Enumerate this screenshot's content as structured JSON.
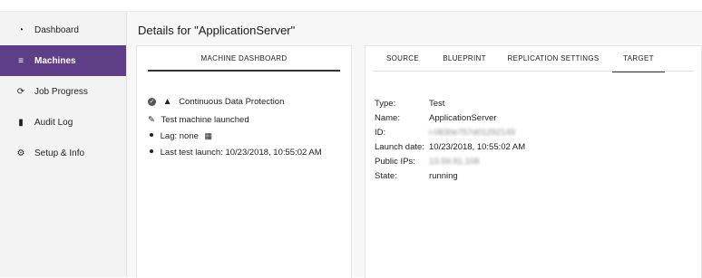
{
  "sidebar": {
    "items": [
      {
        "label": "Dashboard",
        "icon": "dashboard-gauge-icon",
        "active": false
      },
      {
        "label": "Machines",
        "icon": "list-icon",
        "active": true
      },
      {
        "label": "Job Progress",
        "icon": "progress-spinner-icon",
        "active": false
      },
      {
        "label": "Audit Log",
        "icon": "document-icon",
        "active": false
      },
      {
        "label": "Setup & Info",
        "icon": "gear-icon",
        "active": false
      }
    ]
  },
  "page": {
    "title": "Details for \"ApplicationServer\""
  },
  "left_panel": {
    "tab_label": "MACHINE DASHBOARD",
    "status_title": "Continuous Data Protection",
    "line_launched": "Test machine launched",
    "lag": "Lag: none",
    "last_test_launch": "Last test launch: 10/23/2018, 10:55:02 AM"
  },
  "right_panel": {
    "tabs": [
      "SOURCE",
      "BLUEPRINT",
      "REPLICATION SETTINGS",
      "TARGET"
    ],
    "active_tab": "TARGET",
    "fields": {
      "type_label": "Type:",
      "type_value": "Test",
      "name_label": "Name:",
      "name_value": "ApplicationServer",
      "id_label": "ID:",
      "id_value": "i-0830e757d01292149",
      "launch_label": "Launch date:",
      "launch_value": "10/23/2018, 10:55:02 AM",
      "ips_label": "Public IPs:",
      "ips_value": "13.59.91.108",
      "state_label": "State:",
      "state_value": "running"
    }
  },
  "colors": {
    "accent": "#5d3e87",
    "sidebar_bg": "#f3f3f3",
    "main_bg": "#f7f7f7"
  }
}
